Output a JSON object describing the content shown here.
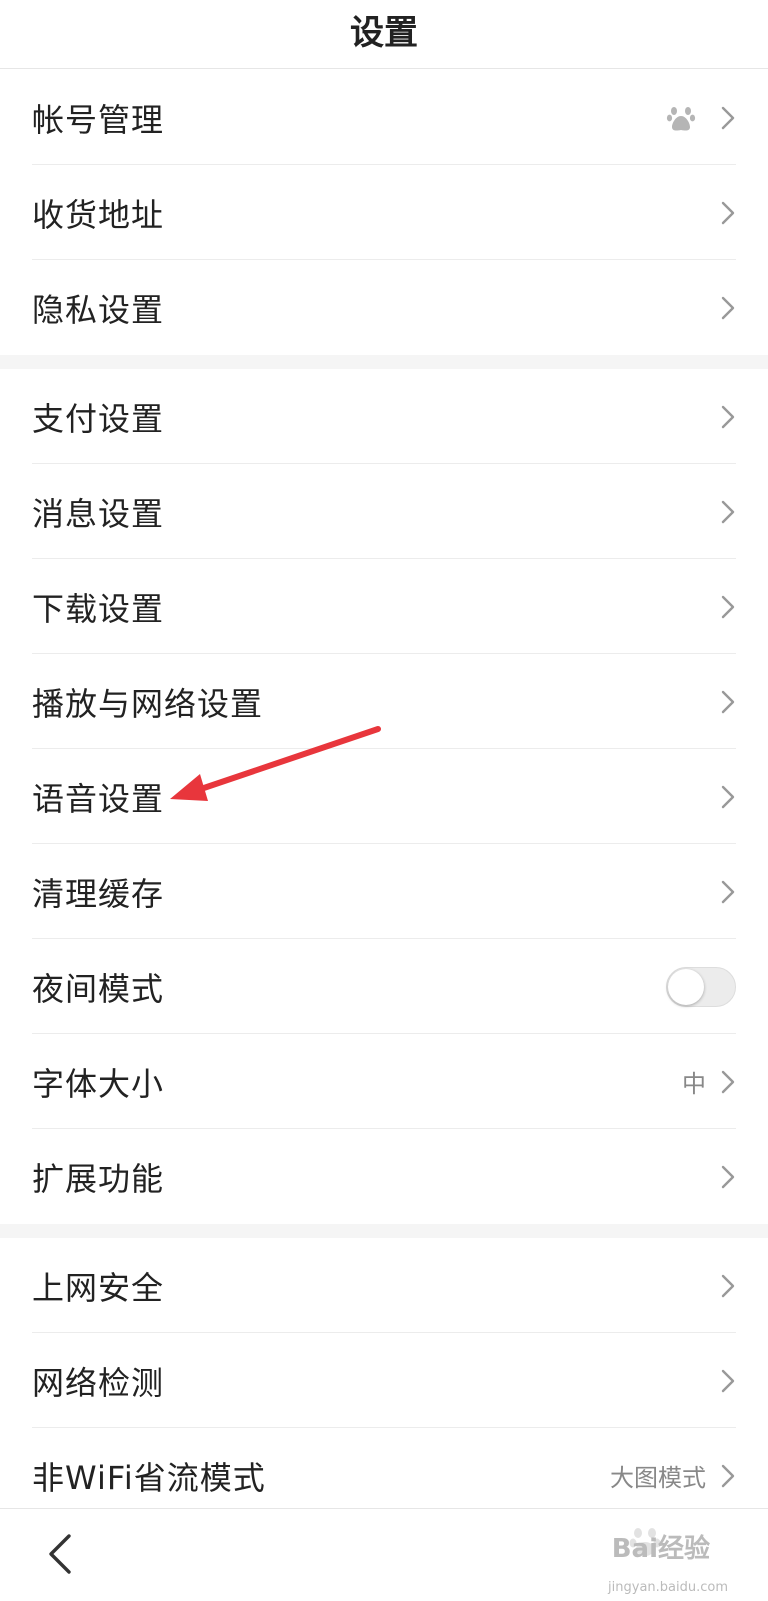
{
  "header": {
    "title": "设置"
  },
  "groups": [
    {
      "items": [
        {
          "label": "帐号管理",
          "icon": "baidu-paw-icon"
        },
        {
          "label": "收货地址"
        },
        {
          "label": "隐私设置"
        }
      ]
    },
    {
      "items": [
        {
          "label": "支付设置"
        },
        {
          "label": "消息设置"
        },
        {
          "label": "下载设置"
        },
        {
          "label": "播放与网络设置"
        },
        {
          "label": "语音设置"
        },
        {
          "label": "清理缓存"
        },
        {
          "label": "夜间模式",
          "toggle": false
        },
        {
          "label": "字体大小",
          "value": "中"
        },
        {
          "label": "扩展功能"
        }
      ]
    },
    {
      "items": [
        {
          "label": "上网安全"
        },
        {
          "label": "网络检测"
        },
        {
          "label": "非WiFi省流模式",
          "value": "大图模式"
        }
      ]
    }
  ],
  "watermark": {
    "text": "Bai经验",
    "sub": "jingyan.baidu.com"
  },
  "colors": {
    "annotation_arrow": "#e8363c",
    "section_gap": "#f5f5f5"
  }
}
